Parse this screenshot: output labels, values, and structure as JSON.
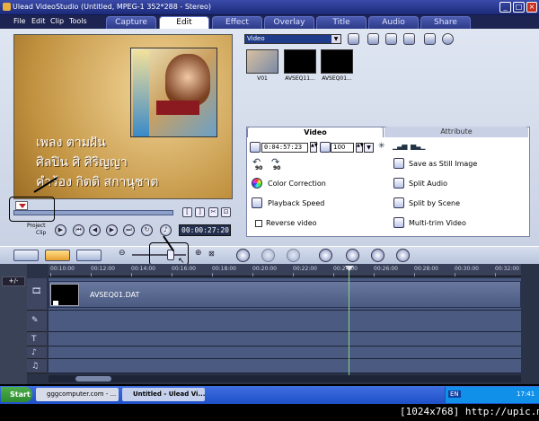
{
  "window": {
    "title": "Ulead VideoStudio (Untitled, MPEG-1 352*288 - Stereo)",
    "min": "_",
    "max": "□",
    "close": "×"
  },
  "menu": {
    "items": [
      "File",
      "Edit",
      "Clip",
      "Tools"
    ]
  },
  "main_tabs": [
    {
      "label": "Capture"
    },
    {
      "label": "Edit"
    },
    {
      "label": "Effect"
    },
    {
      "label": "Overlay"
    },
    {
      "label": "Title"
    },
    {
      "label": "Audio"
    },
    {
      "label": "Share"
    }
  ],
  "preview": {
    "lyrics": [
      "เพลง  ตามฝัน",
      "ศิลปิน ศิ ศิริญญา",
      "คำร้อง กิตติ สกานุชาต"
    ],
    "mode_label_1": "Project",
    "mode_label_2": "Clip",
    "timecode": "00:00:27:20",
    "trim_buttons": [
      "[",
      "]",
      "✂",
      "⊡"
    ]
  },
  "library": {
    "dropdown": "Video",
    "thumbnails": [
      {
        "caption": "V01"
      },
      {
        "caption": "AVSEQ11..."
      },
      {
        "caption": "AVSEQ01..."
      }
    ]
  },
  "options": {
    "tabs": {
      "video": "Video",
      "attribute": "Attribute"
    },
    "duration": "0:04:57:23",
    "volume": "100",
    "rotate_labels": [
      "90",
      "90"
    ],
    "left": [
      "Color Correction",
      "Playback Speed",
      "Reverse video"
    ],
    "right": [
      "Save as Still Image",
      "Split Audio",
      "Split by Scene",
      "Multi-trim Video"
    ]
  },
  "timeline": {
    "ticks": [
      "00:10:00",
      "00:12:00",
      "00:14:00",
      "00:16:00",
      "00:18:00",
      "00:20:00",
      "00:22:00",
      "00:24:00",
      "00:26:00",
      "00:28:00",
      "00:30:00",
      "00:32:00"
    ],
    "clip_name": "AVSEQ01.DAT",
    "track_icons": [
      "🎞",
      "✎",
      "T",
      "♪",
      "♫"
    ]
  },
  "taskbar": {
    "start": "Start",
    "tasks": [
      "gggcomputer.com - ...",
      "Untitled - Ulead Vi..."
    ],
    "tray_lang": "EN",
    "clock": "17:41"
  },
  "footer": "[1024x768] http://upic.me/"
}
